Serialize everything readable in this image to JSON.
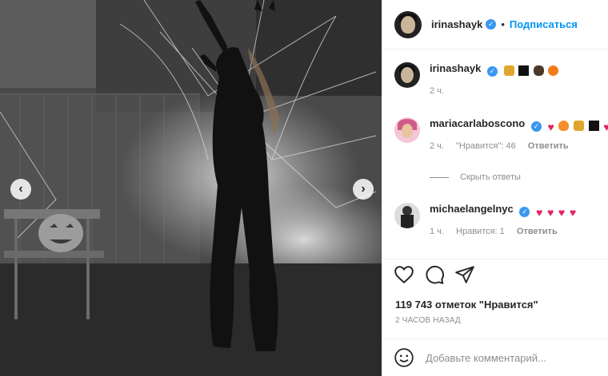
{
  "post": {
    "author": "irinashayk",
    "follow_label": "Подписаться",
    "separator": "•"
  },
  "comments": [
    {
      "user": "irinashayk",
      "emojis": [
        "cat-emoji",
        "black-square-emoji",
        "monkey-emoji",
        "pumpkin-emoji"
      ],
      "time": "2 ч.",
      "likes": "",
      "reply": ""
    },
    {
      "user": "mariacarlaboscono",
      "emojis": [
        "heart-emoji",
        "fire-emoji",
        "cat-emoji",
        "black-square-emoji",
        "heart-emoji"
      ],
      "time": "2 ч.",
      "likes": "\"Нравится\": 46",
      "reply": "Ответить"
    },
    {
      "user": "michaelangelnyc",
      "emojis": [
        "heart-emoji",
        "heart-emoji",
        "heart-emoji",
        "heart-emoji"
      ],
      "time": "1 ч.",
      "likes": "Нравится: 1",
      "reply": "Ответить"
    }
  ],
  "hide_replies_label": "Скрыть ответы",
  "likes_text": "119 743 отметок \"Нравится\"",
  "timestamp": "2 ЧАСОВ НАЗАД",
  "comment_placeholder": "Добавьте комментарий...",
  "colors": {
    "accent": "#0095f6",
    "verified": "#3897f0",
    "heart": "#e0245e",
    "muted": "#8e8e8e"
  }
}
